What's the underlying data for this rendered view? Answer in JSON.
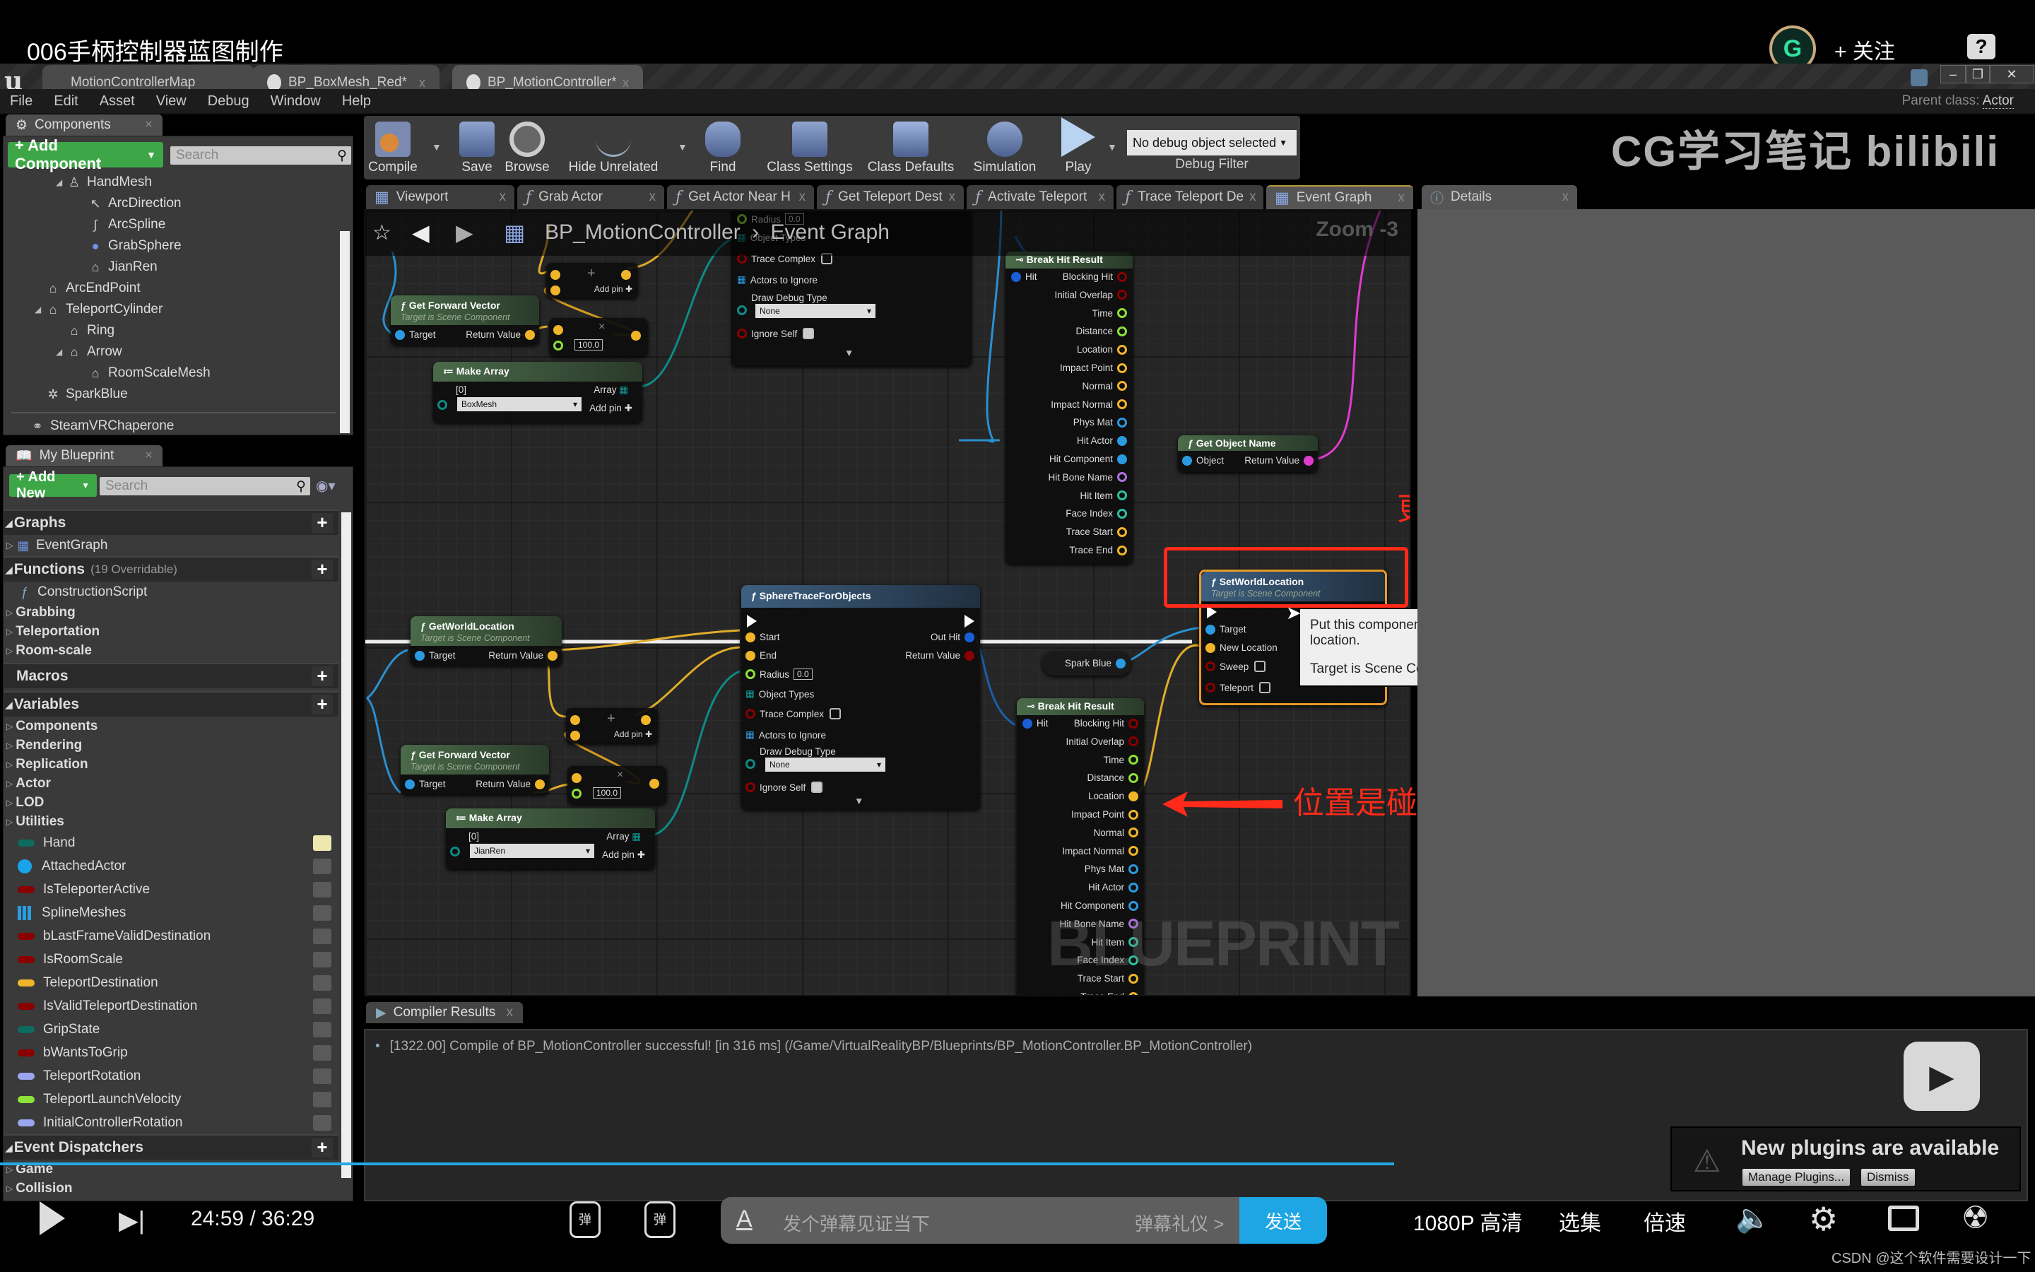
{
  "video": {
    "title": "006手柄控制器蓝图制作",
    "follow_label": "+ 关注",
    "help_label": "?",
    "watermark_text": "CG学习笔记 bilibili",
    "csdn_credit": "CSDN @这个软件需要设计一下"
  },
  "editor": {
    "doc_tabs": [
      {
        "label": "MotionControllerMap",
        "active": false
      },
      {
        "label": "BP_BoxMesh_Red*",
        "active": false
      },
      {
        "label": "BP_MotionController*",
        "active": true
      }
    ],
    "menu": [
      "File",
      "Edit",
      "Asset",
      "View",
      "Debug",
      "Window",
      "Help"
    ],
    "parent_class_label": "Parent class:",
    "parent_class_value": "Actor"
  },
  "components_panel": {
    "tab_label": "Components",
    "add_button": "+ Add Component",
    "search_placeholder": "Search",
    "items": [
      {
        "label": "HandMesh",
        "icon": "skeletal-mesh-icon",
        "depth": 2,
        "expanded": true
      },
      {
        "label": "ArcDirection",
        "icon": "arrow-icon",
        "depth": 3
      },
      {
        "label": "ArcSpline",
        "icon": "spline-icon",
        "depth": 3
      },
      {
        "label": "GrabSphere",
        "icon": "sphere-icon",
        "depth": 3
      },
      {
        "label": "JianRen",
        "icon": "scene-component-icon",
        "depth": 3
      },
      {
        "label": "ArcEndPoint",
        "icon": "scene-component-icon",
        "depth": 1
      },
      {
        "label": "TeleportCylinder",
        "icon": "scene-component-icon",
        "depth": 1,
        "expanded": true
      },
      {
        "label": "Ring",
        "icon": "scene-component-icon",
        "depth": 2
      },
      {
        "label": "Arrow",
        "icon": "scene-component-icon",
        "depth": 2,
        "expanded": true
      },
      {
        "label": "RoomScaleMesh",
        "icon": "scene-component-icon",
        "depth": 3
      },
      {
        "label": "SparkBlue",
        "icon": "particle-icon",
        "depth": 1
      }
    ],
    "extra_item": "SteamVRChaperone"
  },
  "my_blueprint": {
    "tab_label": "My Blueprint",
    "add_button": "+ Add New",
    "search_placeholder": "Search",
    "graphs_header": "Graphs",
    "graphs": [
      "EventGraph"
    ],
    "functions_header": "Functions",
    "functions_count": "(19 Overridable)",
    "functions": [
      "ConstructionScript"
    ],
    "function_categories": [
      "Grabbing",
      "Teleportation",
      "Room-scale"
    ],
    "macros_header": "Macros",
    "variables_header": "Variables",
    "variable_categories": [
      "Components",
      "Rendering",
      "Replication",
      "Actor",
      "LOD",
      "Utilities"
    ],
    "variables": [
      {
        "name": "Hand",
        "color": "#0e6b5e",
        "public": true
      },
      {
        "name": "AttachedActor",
        "color": "#1aa3e8",
        "type": "object"
      },
      {
        "name": "IsTeleporterActive",
        "color": "#8a0000"
      },
      {
        "name": "SplineMeshes",
        "color": "#2a9ee0",
        "type": "array"
      },
      {
        "name": "bLastFrameValidDestination",
        "color": "#8a0000"
      },
      {
        "name": "IsRoomScale",
        "color": "#8a0000"
      },
      {
        "name": "TeleportDestination",
        "color": "#f0b52a"
      },
      {
        "name": "IsValidTeleportDestination",
        "color": "#8a0000"
      },
      {
        "name": "GripState",
        "color": "#0e6b5e"
      },
      {
        "name": "bWantsToGrip",
        "color": "#8a0000"
      },
      {
        "name": "TeleportRotation",
        "color": "#9aa6f0"
      },
      {
        "name": "TeleportLaunchVelocity",
        "color": "#8ee03a"
      },
      {
        "name": "InitialControllerRotation",
        "color": "#9aa6f0"
      }
    ],
    "dispatchers_header": "Event Dispatchers",
    "dispatcher_categories": [
      "Game",
      "Collision"
    ]
  },
  "toolbar": {
    "buttons": [
      "Compile",
      "Save",
      "Browse",
      "Hide Unrelated",
      "Find",
      "Class Settings",
      "Class Defaults",
      "Simulation",
      "Play"
    ],
    "debug_select": "No debug object selected",
    "debug_label": "Debug Filter"
  },
  "graph_tabs": [
    {
      "label": "Viewport",
      "type": "viewport"
    },
    {
      "label": "Grab Actor",
      "type": "function"
    },
    {
      "label": "Get Actor Near H",
      "type": "function"
    },
    {
      "label": "Get Teleport Dest",
      "type": "function"
    },
    {
      "label": "Activate Teleport",
      "type": "function"
    },
    {
      "label": "Trace Teleport De",
      "type": "function"
    },
    {
      "label": "Event Graph",
      "type": "graph",
      "active": true
    }
  ],
  "details_tab": "Details",
  "graph": {
    "breadcrumb_root": "BP_MotionController",
    "breadcrumb_leaf": "Event Graph",
    "zoom": "Zoom -3",
    "watermark": "BLUEPRINT",
    "nodes": {
      "get_forward_top": {
        "title": "Get Forward Vector",
        "subtitle": "Target is Scene Component",
        "in": "Target",
        "out": "Return Value"
      },
      "add_top": {
        "label": "Add pin"
      },
      "mul_top": {
        "value": "100.0"
      },
      "make_array_top": {
        "title": "Make Array",
        "index": "[0]",
        "value": "BoxMesh",
        "out": "Array",
        "add": "Add pin"
      },
      "trace_top": {
        "radius_label": "Radius",
        "radius": "0.0",
        "object_types": "Object Types",
        "trace_complex": "Trace Complex",
        "actors_ignore": "Actors to Ignore",
        "debug_type": "Draw Debug Type",
        "debug_value": "None",
        "ignore_self": "Ignore Self"
      },
      "break_hit_top": {
        "title": "Break Hit Result",
        "in": "Hit",
        "outs": [
          "Blocking Hit",
          "Initial Overlap",
          "Time",
          "Distance",
          "Location",
          "Impact Point",
          "Normal",
          "Impact Normal",
          "Phys Mat",
          "Hit Actor",
          "Hit Component",
          "Hit Bone Name",
          "Hit Item",
          "Face Index",
          "Trace Start",
          "Trace End"
        ]
      },
      "get_object_name": {
        "title": "Get Object Name",
        "in": "Object",
        "out": "Return Value"
      },
      "get_world_location": {
        "title": "GetWorldLocation",
        "subtitle": "Target is Scene Component",
        "in": "Target",
        "out": "Return Value"
      },
      "get_forward_bottom": {
        "title": "Get Forward Vector",
        "subtitle": "Target is Scene Component",
        "in": "Target",
        "out": "Return Value"
      },
      "add_bottom": {
        "label": "Add pin"
      },
      "mul_bottom": {
        "value": "100.0"
      },
      "make_array_bottom": {
        "title": "Make Array",
        "index": "[0]",
        "value": "JianRen",
        "out": "Array",
        "add": "Add pin"
      },
      "sphere_trace": {
        "title": "SphereTraceForObjects",
        "start": "Start",
        "end": "End",
        "radius_label": "Radius",
        "radius": "0.0",
        "object_types": "Object Types",
        "trace_complex": "Trace Complex",
        "actors_ignore": "Actors to Ignore",
        "debug_type": "Draw Debug Type",
        "debug_value": "None",
        "ignore_self": "Ignore Self",
        "out_hit": "Out Hit",
        "return_value": "Return Value"
      },
      "spark_blue": {
        "label": "Spark Blue"
      },
      "break_hit_bottom": {
        "title": "Break Hit Result",
        "in": "Hit",
        "outs": [
          "Blocking Hit",
          "Initial Overlap",
          "Time",
          "Distance",
          "Location",
          "Impact Point",
          "Normal",
          "Impact Normal",
          "Phys Mat",
          "Hit Actor",
          "Hit Component",
          "Hit Bone Name",
          "Hit Item",
          "Face Index",
          "Trace Start",
          "Trace End"
        ]
      },
      "set_world_location": {
        "title": "SetWorldLocation",
        "subtitle": "Target is Scene Component",
        "pins": [
          "Target",
          "New Location",
          "Sweep",
          "Teleport"
        ]
      }
    },
    "tooltip_line1": "Put this component at the specified location in world space. Updates relative location to achieve the final world location.",
    "tooltip_line2": "Target is Scene Component"
  },
  "annotations": {
    "top": "更改火花的位置",
    "bottom": "位置是碰撞的位置"
  },
  "compiler": {
    "tab_label": "Compiler Results",
    "message": "[1322.00] Compile of BP_MotionController successful! [in 316 ms] (/Game/VirtualRealityBP/Blueprints/BP_MotionController.BP_MotionController)"
  },
  "notification": {
    "title": "New plugins are available",
    "manage_button": "Manage Plugins...",
    "dismiss_button": "Dismiss"
  },
  "player": {
    "time_current": "24:59",
    "time_total": "36:29",
    "progress": 0.685,
    "danmaku_placeholder": "发个弹幕见证当下",
    "danmaku_etiquette": "弹幕礼仪 >",
    "send_label": "发送",
    "quality": "1080P 高清",
    "episodes": "选集",
    "speed": "倍速"
  }
}
